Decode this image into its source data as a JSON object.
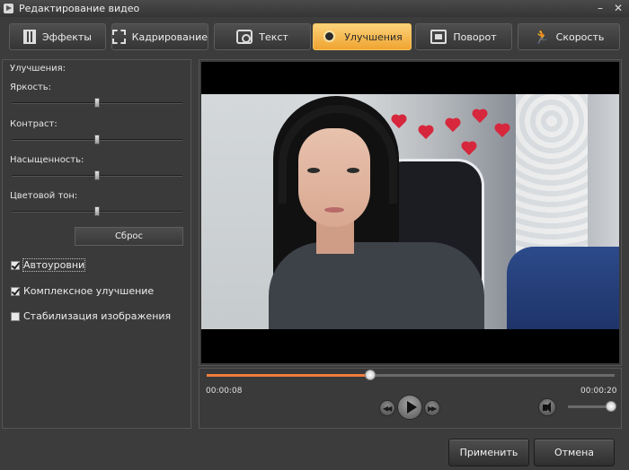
{
  "window": {
    "title": "Редактирование видео",
    "minimize_glyph": "–",
    "close_glyph": "✕"
  },
  "tabs": [
    {
      "label": "Эффекты",
      "icon": "film-effects-icon",
      "active": false
    },
    {
      "label": "Кадрирование",
      "icon": "crop-icon",
      "active": false
    },
    {
      "label": "Текст",
      "icon": "text-icon",
      "active": false
    },
    {
      "label": "Улучшения",
      "icon": "brightness-icon",
      "active": true
    },
    {
      "label": "Поворот",
      "icon": "rotate-icon",
      "active": false
    },
    {
      "label": "Скорость",
      "icon": "running-man-icon",
      "active": false
    }
  ],
  "enhancements": {
    "title": "Улучшения:",
    "sliders": [
      {
        "label": "Яркость:",
        "value": 0.5
      },
      {
        "label": "Контраст:",
        "value": 0.5
      },
      {
        "label": "Насыщенность:",
        "value": 0.5
      },
      {
        "label": "Цветовой тон:",
        "value": 0.5
      }
    ],
    "reset_label": "Сброс",
    "checkboxes": [
      {
        "label": "Автоуровни",
        "checked": true
      },
      {
        "label": "Комплексное улучшение",
        "checked": true
      },
      {
        "label": "Стабилизация изображения",
        "checked": false
      }
    ]
  },
  "player": {
    "current_time": "00:00:08",
    "total_time": "00:00:20",
    "progress": 0.4,
    "volume": 0.95,
    "accent_color": "#ef7d3c"
  },
  "actions": {
    "apply_label": "Применить",
    "cancel_label": "Отмена"
  }
}
